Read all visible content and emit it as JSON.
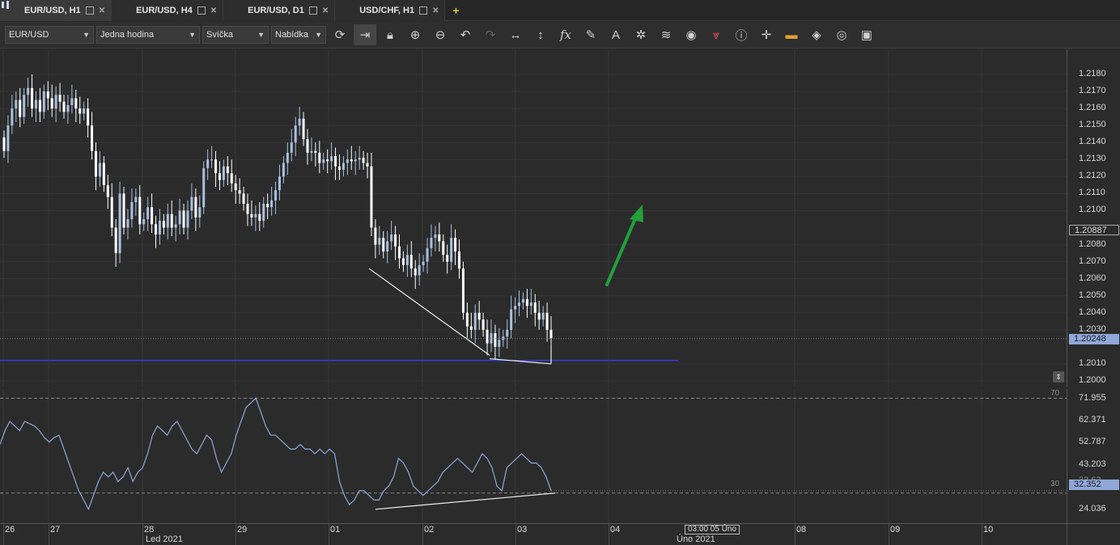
{
  "tabs": [
    {
      "label": "EUR/USD, H1",
      "active": true
    },
    {
      "label": "EUR/USD, H4",
      "active": false
    },
    {
      "label": "EUR/USD, D1",
      "active": false
    },
    {
      "label": "USD/CHF, H1",
      "active": false
    }
  ],
  "toolbar": {
    "instrument": "EUR/USD",
    "period": "Jedna hodina",
    "chart_type": "Svíčka",
    "offer_side": "Nabídka",
    "tools": [
      "refresh-icon",
      "shift-icon",
      "lock-icon",
      "zoom-in-icon",
      "zoom-out-icon",
      "undo-icon",
      "redo-icon",
      "horizontal-scale-icon",
      "vertical-scale-icon",
      "indicator-fx-icon",
      "pencil-icon",
      "text-icon",
      "crosshair-icon",
      "layers-icon",
      "eye-icon",
      "alert-icon",
      "info-icon",
      "cursor-cross-icon",
      "color-bar-icon",
      "fill-icon",
      "theme-icon",
      "save-icon"
    ]
  },
  "price_axis": {
    "labels": [
      "1.2180",
      "1.2170",
      "1.2160",
      "1.2150",
      "1.2140",
      "1.2130",
      "1.2120",
      "1.2110",
      "1.2100",
      "1.2080",
      "1.2070",
      "1.2060",
      "1.2050",
      "1.2040",
      "1.2030",
      "1.2010",
      "1.2000"
    ],
    "tag_current": "1.20248",
    "tag_level": "1.20887"
  },
  "osc_axis": {
    "labels": [
      "71.955",
      "62.371",
      "52.787",
      "43.203",
      "24.036"
    ],
    "level_high": "70",
    "level_low": "30",
    "tag_current": "32.352",
    "tag_hidden": "33.62"
  },
  "time_axis": {
    "days": [
      "26",
      "27",
      "28",
      "29",
      "01",
      "02",
      "03",
      "04",
      "08",
      "09",
      "10"
    ],
    "months": [
      "Led 2021",
      "Úno 2021"
    ],
    "cursor_time": "03:00 05 Úno"
  },
  "colors": {
    "bull": "#a9c0e0",
    "bear": "#ffffff",
    "support": "#3a3adb",
    "arrow": "#22a03a",
    "osc_line": "#8fa8d8"
  },
  "chart_data": {
    "type": "candlestick",
    "symbol": "EUR/USD",
    "timeframe": "H1",
    "ylim": [
      1.2,
      1.219
    ],
    "support_level": 1.2012,
    "current_price": 1.20248,
    "closes": [
      1.2135,
      1.215,
      1.216,
      1.2165,
      1.2155,
      1.2168,
      1.2172,
      1.216,
      1.2165,
      1.2158,
      1.217,
      1.2166,
      1.216,
      1.2168,
      1.2164,
      1.2158,
      1.2162,
      1.2166,
      1.216,
      1.2157,
      1.216,
      1.215,
      1.2135,
      1.212,
      1.2128,
      1.2115,
      1.2108,
      1.209,
      1.2075,
      1.211,
      1.209,
      1.2095,
      1.2105,
      1.2108,
      1.2092,
      1.2095,
      1.2102,
      1.2092,
      1.2086,
      1.2094,
      1.209,
      1.2098,
      1.209,
      1.2092,
      1.21,
      1.209,
      1.21,
      1.2108,
      1.2096,
      1.2102,
      1.2125,
      1.213,
      1.213,
      1.2122,
      1.2118,
      1.2126,
      1.2122,
      1.2116,
      1.2112,
      1.211,
      1.2104,
      1.2098,
      1.2096,
      1.2098,
      1.2094,
      1.2104,
      1.2102,
      1.2106,
      1.2112,
      1.212,
      1.2128,
      1.2134,
      1.214,
      1.215,
      1.2154,
      1.2142,
      1.2134,
      1.2135,
      1.2134,
      1.2128,
      1.213,
      1.2129,
      1.2132,
      1.2126,
      1.2124,
      1.2128,
      1.213,
      1.2129,
      1.213,
      1.2131,
      1.2128,
      1.2126,
      1.209,
      1.208,
      1.2084,
      1.2076,
      1.2082,
      1.2086,
      1.2079,
      1.2072,
      1.2068,
      1.2074,
      1.2066,
      1.2062,
      1.2068,
      1.207,
      1.2078,
      1.2084,
      1.2086,
      1.2082,
      1.2074,
      1.207,
      1.2084,
      1.2076,
      1.2066,
      1.204,
      1.2032,
      1.203,
      1.204,
      1.2036,
      1.203,
      1.2022,
      1.2028,
      1.202,
      1.2024,
      1.2026,
      1.203,
      1.2042,
      1.2044,
      1.2046,
      1.2048,
      1.2044,
      1.2046,
      1.204,
      1.2036,
      1.204,
      1.203,
      1.2025
    ],
    "rsi": [
      52,
      58,
      62,
      60,
      58,
      62,
      61,
      60,
      58,
      55,
      53,
      55,
      56,
      50,
      44,
      38,
      32,
      28,
      24,
      30,
      36,
      40,
      38,
      40,
      36,
      38,
      42,
      36,
      40,
      42,
      48,
      56,
      60,
      58,
      56,
      60,
      62,
      58,
      54,
      50,
      48,
      52,
      56,
      54,
      46,
      40,
      44,
      48,
      56,
      62,
      68,
      70,
      72,
      66,
      60,
      56,
      56,
      54,
      52,
      50,
      50,
      52,
      50,
      50,
      48,
      50,
      48,
      50,
      48,
      36,
      30,
      26,
      28,
      32,
      32,
      30,
      28,
      28,
      32,
      34,
      38,
      46,
      44,
      40,
      34,
      32,
      30,
      32,
      34,
      36,
      40,
      42,
      44,
      46,
      44,
      42,
      40,
      44,
      48,
      46,
      42,
      34,
      32,
      42,
      44,
      46,
      48,
      46,
      44,
      44,
      42,
      38,
      32
    ],
    "trendlines": [
      {
        "name": "price-trendline",
        "from": 1.2066,
        "to": 1.2015
      },
      {
        "name": "price-bottom-line",
        "from": 1.2013,
        "to": 1.201
      },
      {
        "name": "rsi-trendline",
        "from": 24,
        "to": 31
      }
    ]
  }
}
